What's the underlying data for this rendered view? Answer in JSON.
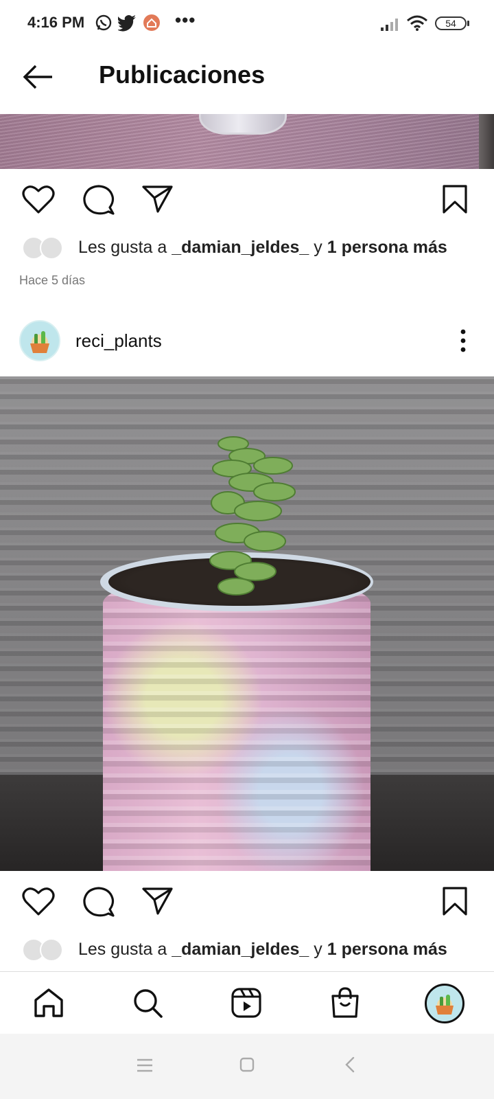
{
  "status_bar": {
    "time": "4:16 PM",
    "app_icons": [
      "whatsapp-icon",
      "twitter-icon",
      "home-app-icon"
    ],
    "more": "•••",
    "battery": "54"
  },
  "header": {
    "title": "Publicaciones"
  },
  "post1": {
    "likes_prefix": "Les gusta a ",
    "likes_user": "_damian_jeldes_",
    "likes_join": " y ",
    "likes_others": "1 persona más",
    "timestamp": "Hace 5 días"
  },
  "post2": {
    "username": "reci_plants",
    "likes_prefix": "Les gusta a ",
    "likes_user": "_damian_jeldes_",
    "likes_join": " y ",
    "likes_others": "1 persona más"
  },
  "bottom_nav": {
    "items": [
      "home-icon",
      "search-icon",
      "reels-icon",
      "shop-icon",
      "profile-avatar"
    ]
  },
  "colors": {
    "text": "#111111",
    "muted": "#777777"
  }
}
